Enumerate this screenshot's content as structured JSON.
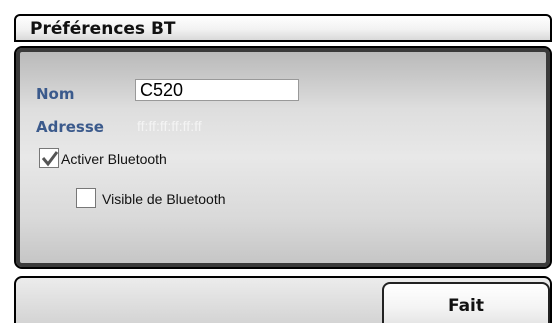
{
  "header": {
    "title": "Préférences BT"
  },
  "form": {
    "name_label": "Nom",
    "name_value": "C520",
    "address_label": "Adresse",
    "address_value": "ff:ff:ff:ff:ff:ff",
    "bluetooth_enable": {
      "label": "Activer Bluetooth",
      "checked": true
    },
    "bluetooth_visible": {
      "label": "Visible de Bluetooth",
      "checked": false
    }
  },
  "footer": {
    "done_label": "Fait"
  }
}
